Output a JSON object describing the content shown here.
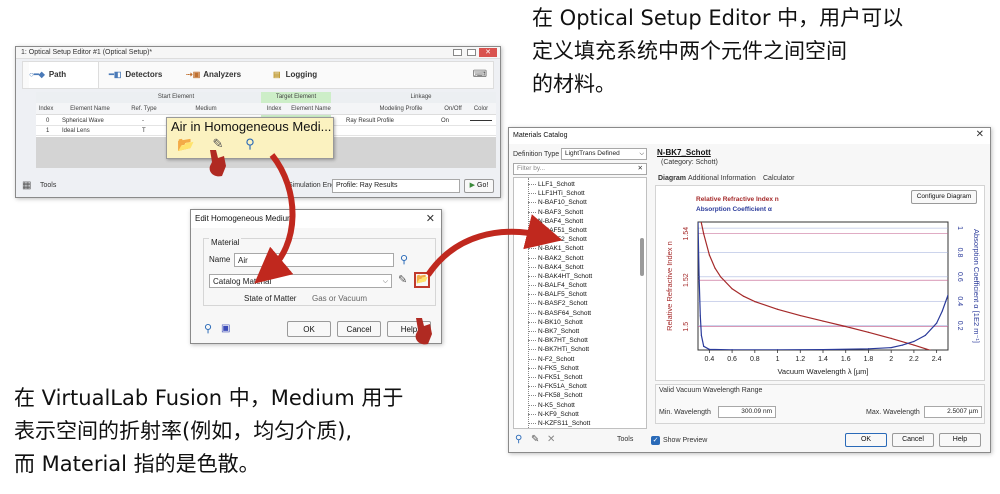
{
  "annotations": {
    "top_line1": "在 Optical Setup Editor 中，用户可以",
    "top_line2": "定义填充系统中两个元件之间空间",
    "top_line3": "的材料。",
    "bottom_line1": "在 VirtualLab Fusion 中，Medium 用于",
    "bottom_line2": "表示空间的折射率(例如，均匀介质),",
    "bottom_line3": "而 Material 指的是色散。"
  },
  "editor": {
    "title": "1: Optical Setup Editor #1 (Optical Setup)*",
    "tabs": [
      "Path",
      "Detectors",
      "Analyzers",
      "Logging"
    ],
    "group_start": "Start Element",
    "group_target": "Target Element",
    "group_linkage": "Linkage",
    "columns": [
      "Index",
      "Element Name",
      "Ref. Type",
      "Medium",
      "Index",
      "Element Name",
      "Modeling Profile",
      "On/Off",
      "Color"
    ],
    "rows": [
      {
        "index": "0",
        "name": "Spherical Wave",
        "ref": "-",
        "profile": "Ray Result Profile",
        "onoff": "On"
      },
      {
        "index": "1",
        "name": "Ideal Lens",
        "ref": "T",
        "profile": "",
        "onoff": ""
      }
    ],
    "tooltip": "Air in Homogeneous Medi...",
    "tools_label": "Tools",
    "sim_engine_label": "Simulation Engine",
    "sim_engine_value": "Profile: Ray Results",
    "go_label": "Go!"
  },
  "homog_dialog": {
    "title": "Edit Homogeneous Medium",
    "material_group": "Material",
    "name_label": "Name",
    "name_value": "Air",
    "catalog_value": "Catalog Material",
    "state_label": "State of Matter",
    "state_value": "Gas or Vacuum",
    "ok": "OK",
    "cancel": "Cancel",
    "help": "Help"
  },
  "catalog": {
    "title": "Materials Catalog",
    "def_type_label": "Definition Type",
    "def_type_value": "LightTrans Defined",
    "filter_placeholder": "Filter by...",
    "items": [
      "LLF1_Schott",
      "LLF1HTi_Schott",
      "N-BAF10_Schott",
      "N-BAF3_Schott",
      "N-BAF4_Schott",
      "N-BAF51_Schott",
      "N-BAF52_Schott",
      "N-BAK1_Schott",
      "N-BAK2_Schott",
      "N-BAK4_Schott",
      "N-BAK4HT_Schott",
      "N-BALF4_Schott",
      "N-BALF5_Schott",
      "N-BASF2_Schott",
      "N-BASF64_Schott",
      "N-BK10_Schott",
      "N-BK7_Schott",
      "N-BK7HT_Schott",
      "N-BK7HTi_Schott",
      "N-F2_Schott",
      "N-FK5_Schott",
      "N-FK51_Schott",
      "N-FK51A_Schott",
      "N-FK58_Schott",
      "N-K5_Schott",
      "N-KF9_Schott",
      "N-KZFS11_Schott"
    ],
    "selected_name": "N-BK7_Schott",
    "category": "(Category: Schott)",
    "tabs": [
      "Diagram",
      "Additional Information",
      "Calculator"
    ],
    "configure_label": "Configure Diagram",
    "legend_n": "Relative Refractive Index n",
    "legend_alpha": "Absorption Coefficient α",
    "range_group": "Valid Vacuum Wavelength Range",
    "min_label": "Min. Wavelength",
    "min_value": "300.09 nm",
    "max_label": "Max. Wavelength",
    "max_value": "2.5007 µm",
    "tools_label": "Tools",
    "show_preview": "Show Preview",
    "ok": "OK",
    "cancel": "Cancel",
    "help": "Help",
    "colors": {
      "n": "#a52a2a",
      "alpha": "#2a3a9a",
      "grid": "#c05a8a"
    }
  },
  "chart_data": {
    "type": "line",
    "xlabel": "Vacuum Wavelength λ [µm]",
    "ylabel": "Relative Refractive Index n",
    "y2label": "Absorption Coefficient α [1E2 m⁻¹]",
    "xlim": [
      0.3,
      2.5
    ],
    "ylim": [
      1.49,
      1.545
    ],
    "y2lim": [
      0,
      1.05
    ],
    "xticks": [
      "0.4",
      "0.6",
      "0.8",
      "1",
      "1.2",
      "1.4",
      "1.6",
      "1.8",
      "2",
      "2.2",
      "2.4"
    ],
    "yticks": [
      "1.5",
      "1.52",
      "1.54"
    ],
    "y2ticks": [
      "0.2",
      "0.4",
      "0.6",
      "0.8",
      "1"
    ],
    "series": [
      {
        "name": "Relative Refractive Index n",
        "axis": "left",
        "x": [
          0.3,
          0.32,
          0.35,
          0.4,
          0.45,
          0.5,
          0.6,
          0.7,
          0.8,
          1.0,
          1.2,
          1.4,
          1.6,
          1.8,
          2.0,
          2.2,
          2.4,
          2.5
        ],
        "y": [
          1.5536,
          1.5467,
          1.5399,
          1.5308,
          1.5252,
          1.5214,
          1.5163,
          1.5131,
          1.5108,
          1.5075,
          1.5048,
          1.5024,
          1.5001,
          1.4976,
          1.495,
          1.4921,
          1.489,
          1.4873
        ]
      },
      {
        "name": "Absorption Coefficient α",
        "axis": "right",
        "x": [
          0.3,
          0.31,
          0.32,
          0.33,
          0.35,
          0.4,
          0.6,
          1.0,
          1.4,
          1.8,
          2.0,
          2.1,
          2.2,
          2.3,
          2.4,
          2.45,
          2.5
        ],
        "y": [
          1.05,
          0.6,
          0.28,
          0.12,
          0.03,
          0.005,
          0.002,
          0.002,
          0.003,
          0.01,
          0.02,
          0.04,
          0.07,
          0.12,
          0.22,
          0.32,
          0.45
        ]
      }
    ]
  }
}
